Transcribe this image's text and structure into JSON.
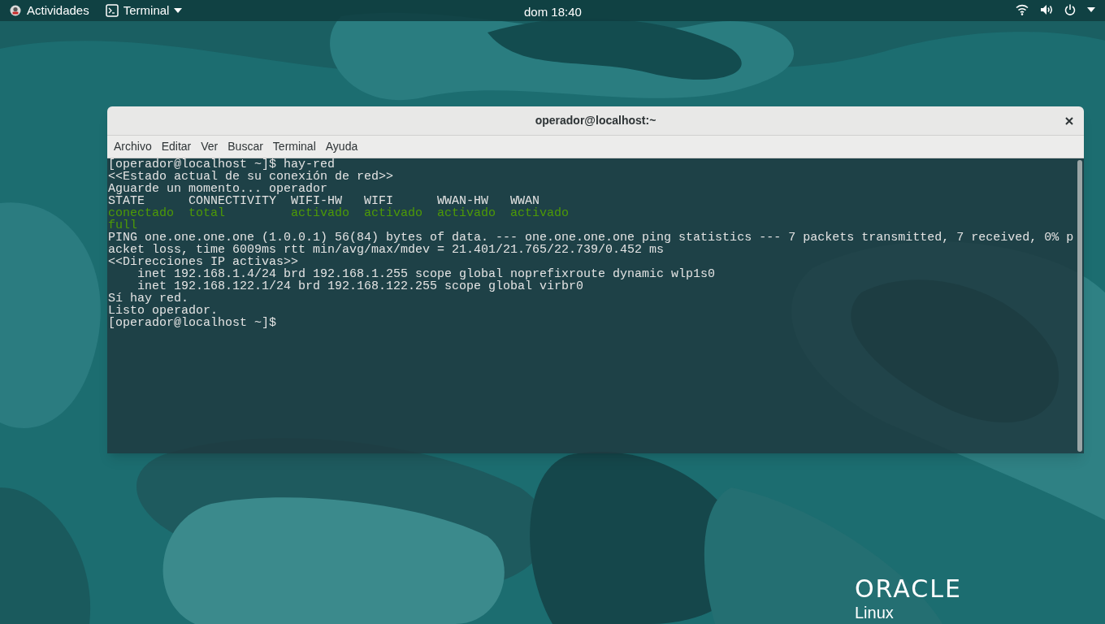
{
  "top_bar": {
    "activities": "Actividades",
    "app_menu": "Terminal",
    "clock": "dom 18:40"
  },
  "terminal": {
    "title": "operador@localhost:~",
    "menu": [
      "Archivo",
      "Editar",
      "Ver",
      "Buscar",
      "Terminal",
      "Ayuda"
    ],
    "lines": [
      {
        "kind": "output",
        "text": "[operador@localhost ~]$ hay-red"
      },
      {
        "kind": "output",
        "text": "<<Estado actual de su conexión de red>>"
      },
      {
        "kind": "output",
        "text": "Aguarde un momento... operador"
      },
      {
        "kind": "output",
        "text": "STATE      CONNECTIVITY  WIFI-HW   WIFI      WWAN-HW   WWAN"
      },
      {
        "kind": "highlight",
        "text": "conectado  total         activado  activado  activado  activado"
      },
      {
        "kind": "highlight",
        "text": "full"
      },
      {
        "kind": "output",
        "text": "PING one.one.one.one (1.0.0.1) 56(84) bytes of data. --- one.one.one.one ping statistics --- 7 packets transmitted, 7 received, 0% p"
      },
      {
        "kind": "output",
        "text": "acket loss, time 6009ms rtt min/avg/max/mdev = 21.401/21.765/22.739/0.452 ms"
      },
      {
        "kind": "output",
        "text": "<<Direcciones IP activas>>"
      },
      {
        "kind": "output",
        "text": "    inet 192.168.1.4/24 brd 192.168.1.255 scope global noprefixroute dynamic wlp1s0"
      },
      {
        "kind": "output",
        "text": "    inet 192.168.122.1/24 brd 192.168.122.255 scope global virbr0"
      },
      {
        "kind": "output",
        "text": "Sí hay red."
      },
      {
        "kind": "output",
        "text": "Listo operador."
      },
      {
        "kind": "output",
        "text": "[operador@localhost ~]$"
      }
    ]
  },
  "logo": {
    "brand": "ORACLE",
    "product": "Linux"
  }
}
